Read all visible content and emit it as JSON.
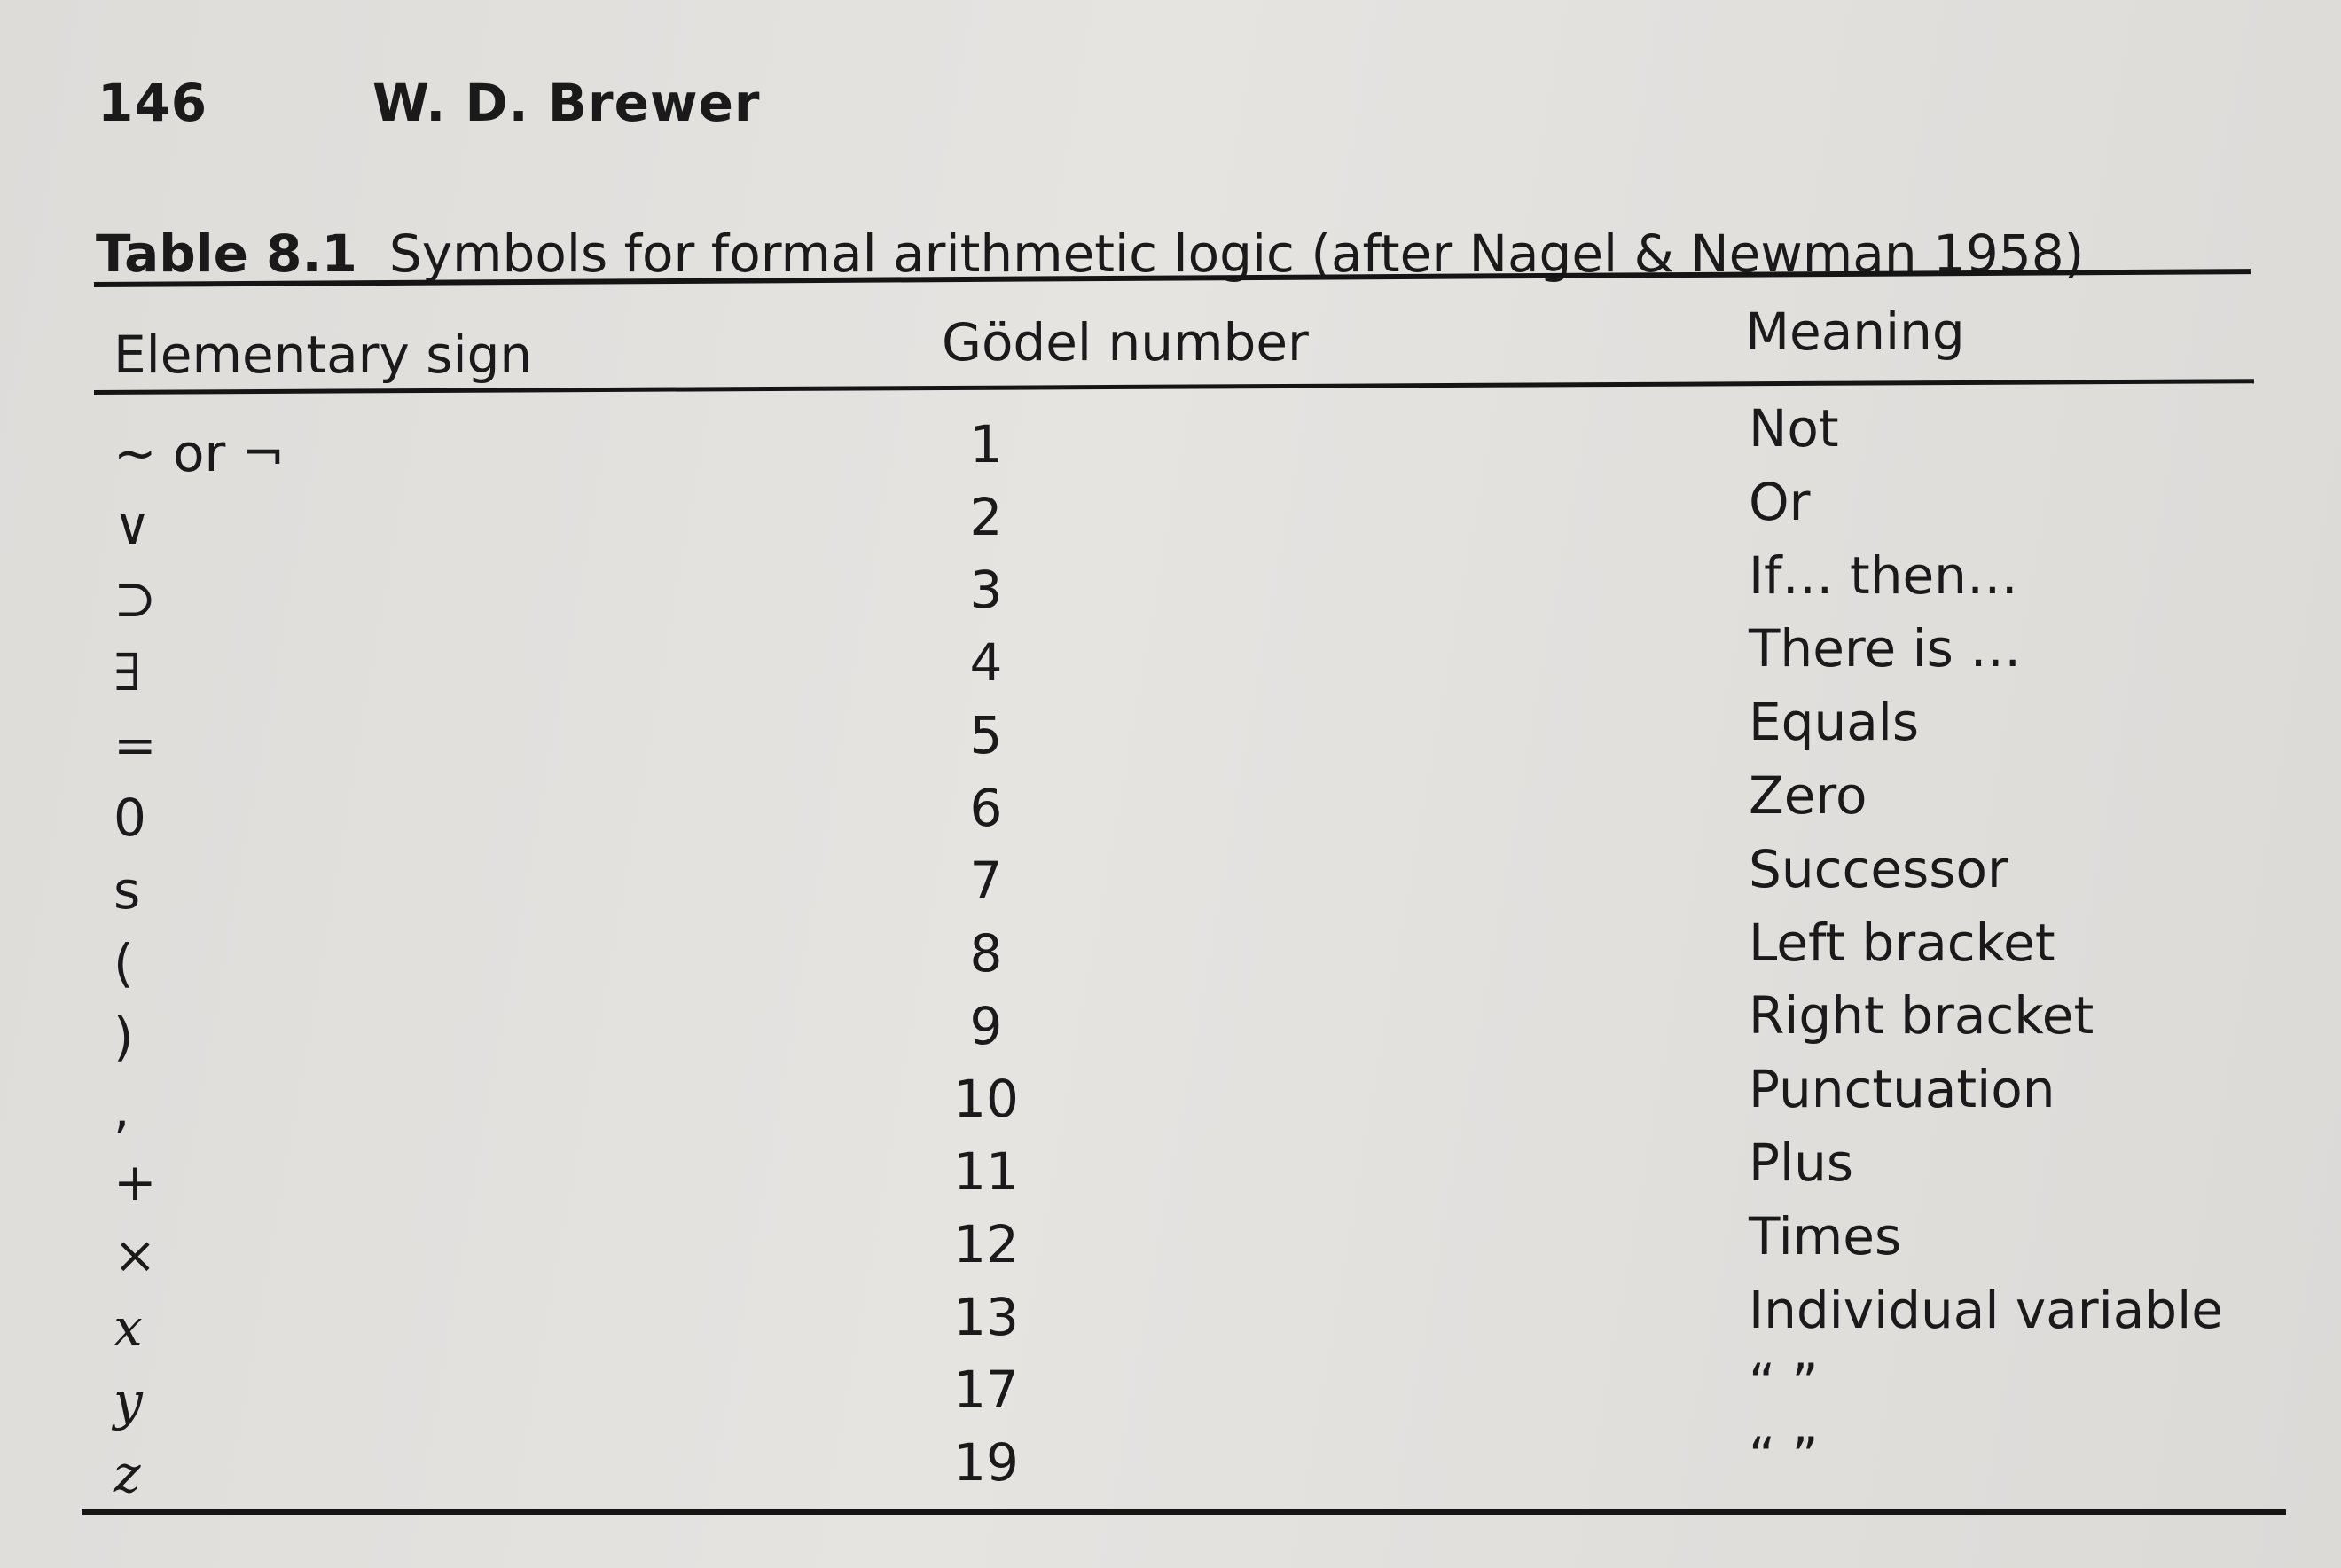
{
  "header": {
    "page_number": "146",
    "author": "W. D. Brewer"
  },
  "table": {
    "label": "Table 8.1",
    "title": "Symbols for formal arithmetic logic (after Nagel & Newman 1958)",
    "columns": {
      "sign": "Elementary sign",
      "number": "Gödel number",
      "meaning": "Meaning"
    },
    "rows": [
      {
        "sign": "~ or ¬",
        "number": "1",
        "meaning": "Not"
      },
      {
        "sign": "∨",
        "number": "2",
        "meaning": "Or"
      },
      {
        "sign": "⊃",
        "number": "3",
        "meaning": "If… then…"
      },
      {
        "sign": "∃",
        "number": "4",
        "meaning": "There is …"
      },
      {
        "sign": "=",
        "number": "5",
        "meaning": "Equals"
      },
      {
        "sign": "0",
        "number": "6",
        "meaning": "Zero"
      },
      {
        "sign": "s",
        "number": "7",
        "meaning": "Successor"
      },
      {
        "sign": "(",
        "number": "8",
        "meaning": "Left bracket"
      },
      {
        "sign": ")",
        "number": "9",
        "meaning": "Right bracket"
      },
      {
        "sign": ",",
        "number": "10",
        "meaning": "Punctuation"
      },
      {
        "sign": "+",
        "number": "11",
        "meaning": "Plus"
      },
      {
        "sign": "×",
        "number": "12",
        "meaning": "Times"
      },
      {
        "sign": "x",
        "number": "13",
        "meaning": "Individual variable"
      },
      {
        "sign": "y",
        "number": "17",
        "meaning": "“ ”"
      },
      {
        "sign": "z",
        "number": "19",
        "meaning": "“ ”"
      }
    ]
  }
}
